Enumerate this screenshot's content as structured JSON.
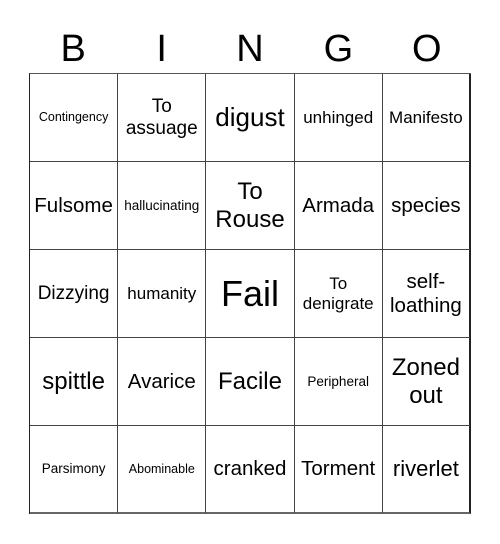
{
  "header": {
    "letters": [
      "B",
      "I",
      "N",
      "G",
      "O"
    ]
  },
  "cells": [
    [
      "Contingency",
      "To assuage",
      "digust",
      "unhinged",
      "Manifesto"
    ],
    [
      "Fulsome",
      "hallucinating",
      "To Rouse",
      "Armada",
      "species"
    ],
    [
      "Dizzying",
      "humanity",
      "Fail",
      "To denigrate",
      "self-loathing"
    ],
    [
      "spittle",
      "Avarice",
      "Facile",
      "Peripheral",
      "Zoned out"
    ],
    [
      "Parsimony",
      "Abominable",
      "cranked",
      "Torment",
      "riverlet"
    ]
  ]
}
